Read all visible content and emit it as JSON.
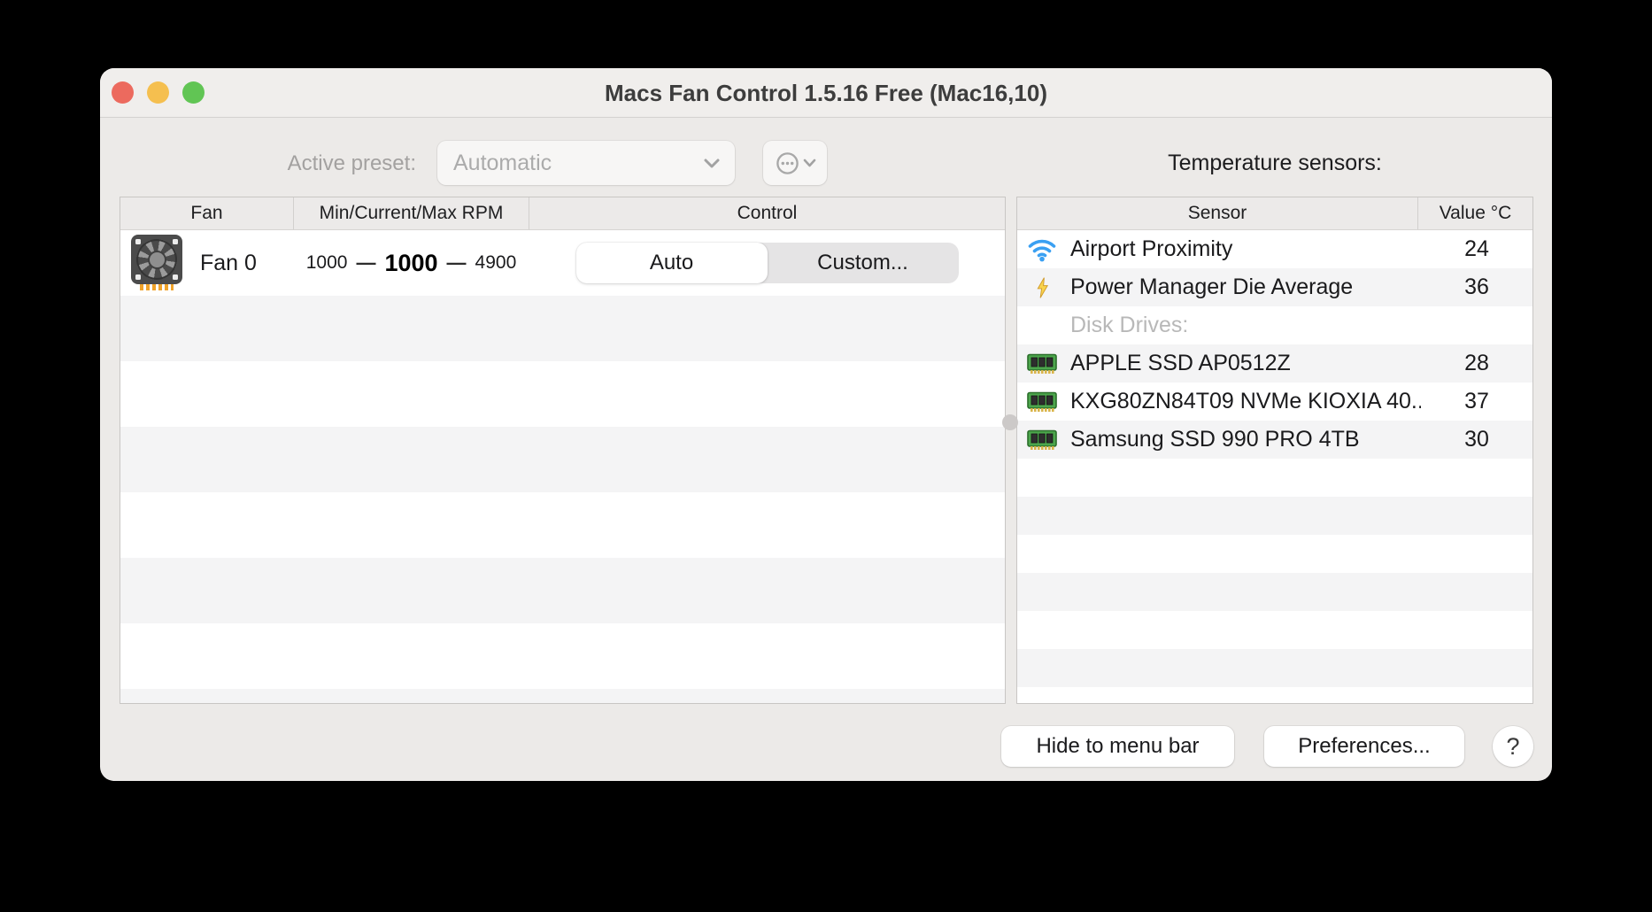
{
  "window": {
    "title": "Macs Fan Control 1.5.16 Free (Mac16,10)"
  },
  "toolbar": {
    "active_preset_label": "Active preset:",
    "preset_value": "Automatic",
    "temperature_sensors_label": "Temperature sensors:"
  },
  "fan_table": {
    "columns": [
      "Fan",
      "Min/Current/Max RPM",
      "Control"
    ],
    "rows": [
      {
        "icon": "fan-icon",
        "name": "Fan 0",
        "min_rpm": "1000",
        "current_rpm": "1000",
        "max_rpm": "4900",
        "dash": "—",
        "controls": {
          "auto": "Auto",
          "custom": "Custom...",
          "selected": "Auto"
        }
      }
    ]
  },
  "sensor_table": {
    "columns": [
      "Sensor",
      "Value °C"
    ],
    "rows": [
      {
        "icon": "wifi-icon",
        "name": "Airport Proximity",
        "value": "24"
      },
      {
        "icon": "lightning-icon",
        "name": "Power Manager Die Average",
        "value": "36"
      },
      {
        "icon": "none",
        "name": "Disk Drives:",
        "value": "",
        "section_header": true
      },
      {
        "icon": "memory-icon",
        "name": "APPLE SSD AP0512Z",
        "value": "28"
      },
      {
        "icon": "memory-icon",
        "name": "KXG80ZN84T09 NVMe KIOXIA 40...",
        "value": "37"
      },
      {
        "icon": "memory-icon",
        "name": "Samsung SSD 990 PRO 4TB",
        "value": "30"
      }
    ]
  },
  "footer": {
    "hide_to_menu_bar": "Hide to menu bar",
    "preferences": "Preferences...",
    "help": "?"
  },
  "colors": {
    "traffic_red": "#ec6a5e",
    "traffic_yellow": "#f5bf4f",
    "traffic_green": "#61c554",
    "wifi_blue": "#3aa0f2",
    "lightning_yellow": "#f9d34c",
    "memory_green": "#4ca64c",
    "fan_pin_orange": "#f0a32a",
    "window_bg": "#eceae8",
    "row_stripe": "#f4f4f5"
  }
}
